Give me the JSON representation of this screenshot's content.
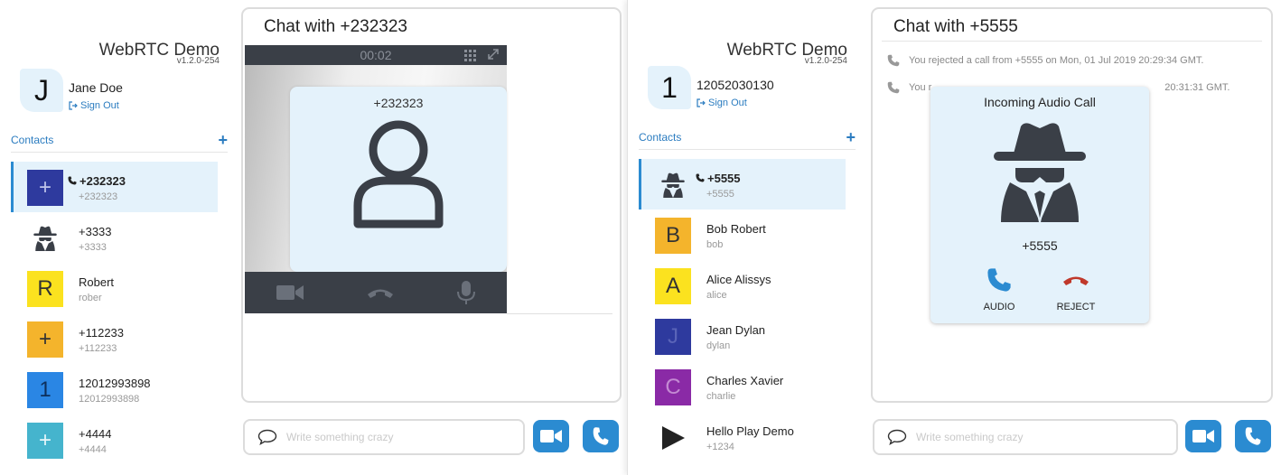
{
  "left": {
    "brand": "WebRTC Demo",
    "version": "v1.2.0-254",
    "user": {
      "initial": "J",
      "name": "Jane Doe"
    },
    "sign_out": "Sign Out",
    "contacts_label": "Contacts",
    "add_label": "+",
    "contacts": [
      {
        "name": "+232323",
        "sub": "+232323",
        "avatar": "+",
        "avatar_bg": "#2e3a9e",
        "avatar_fg": "#bfc4ea",
        "active": true
      },
      {
        "name": "+3333",
        "sub": "+3333",
        "avatar_icon": "spy-icon"
      },
      {
        "name": "Robert",
        "sub": "rober",
        "avatar": "R",
        "avatar_bg": "#fbe21f",
        "avatar_fg": "#333333"
      },
      {
        "name": "+112233",
        "sub": "+112233",
        "avatar": "+",
        "avatar_bg": "#f4b42c",
        "avatar_fg": "#333333"
      },
      {
        "name": "12012993898",
        "sub": "12012993898",
        "avatar": "1",
        "avatar_bg": "#2a86e4",
        "avatar_fg": "#0d2f5c"
      },
      {
        "name": "+4444",
        "sub": "+4444",
        "avatar": "+",
        "avatar_bg": "#45b4cd",
        "avatar_fg": "#e7f6fa"
      }
    ],
    "chat_title": "Chat with +232323",
    "call_timer": "00:02",
    "remote_number": "+232323",
    "input_placeholder": "Write something crazy"
  },
  "right": {
    "brand": "WebRTC Demo",
    "version": "v1.2.0-254",
    "user": {
      "initial": "1",
      "name": "12052030130"
    },
    "sign_out": "Sign Out",
    "contacts_label": "Contacts",
    "add_label": "+",
    "contacts": [
      {
        "name": "+5555",
        "sub": "+5555",
        "avatar_icon": "spy-icon",
        "active": true
      },
      {
        "name": "Bob Robert",
        "sub": "bob",
        "avatar": "B",
        "avatar_bg": "#f4b42c",
        "avatar_fg": "#333333"
      },
      {
        "name": "Alice Alissys",
        "sub": "alice",
        "avatar": "A",
        "avatar_bg": "#fbe21f",
        "avatar_fg": "#333333"
      },
      {
        "name": "Jean Dylan",
        "sub": "dylan",
        "avatar": "J",
        "avatar_bg": "#2e3a9e",
        "avatar_fg": "#5a64b8"
      },
      {
        "name": "Charles Xavier",
        "sub": "charlie",
        "avatar": "C",
        "avatar_bg": "#8a2aa6",
        "avatar_fg": "#c48ad3"
      },
      {
        "name": "Hello Play Demo",
        "sub": "+1234",
        "avatar_icon": "play-icon"
      }
    ],
    "chat_title": "Chat with +5555",
    "call_logs": [
      "You rejected a call from +5555 on Mon, 01 Jul 2019 20:29:34 GMT.",
      "You r",
      "20:31:31 GMT."
    ],
    "incoming": {
      "title": "Incoming Audio Call",
      "number": "+5555",
      "audio_label": "AUDIO",
      "reject_label": "REJECT"
    },
    "input_placeholder": "Write something crazy"
  },
  "colors": {
    "accent": "#2b8bd1",
    "reject": "#c0392b",
    "light_bg": "#e4f2fb",
    "dark_bar": "#3a3f47"
  }
}
